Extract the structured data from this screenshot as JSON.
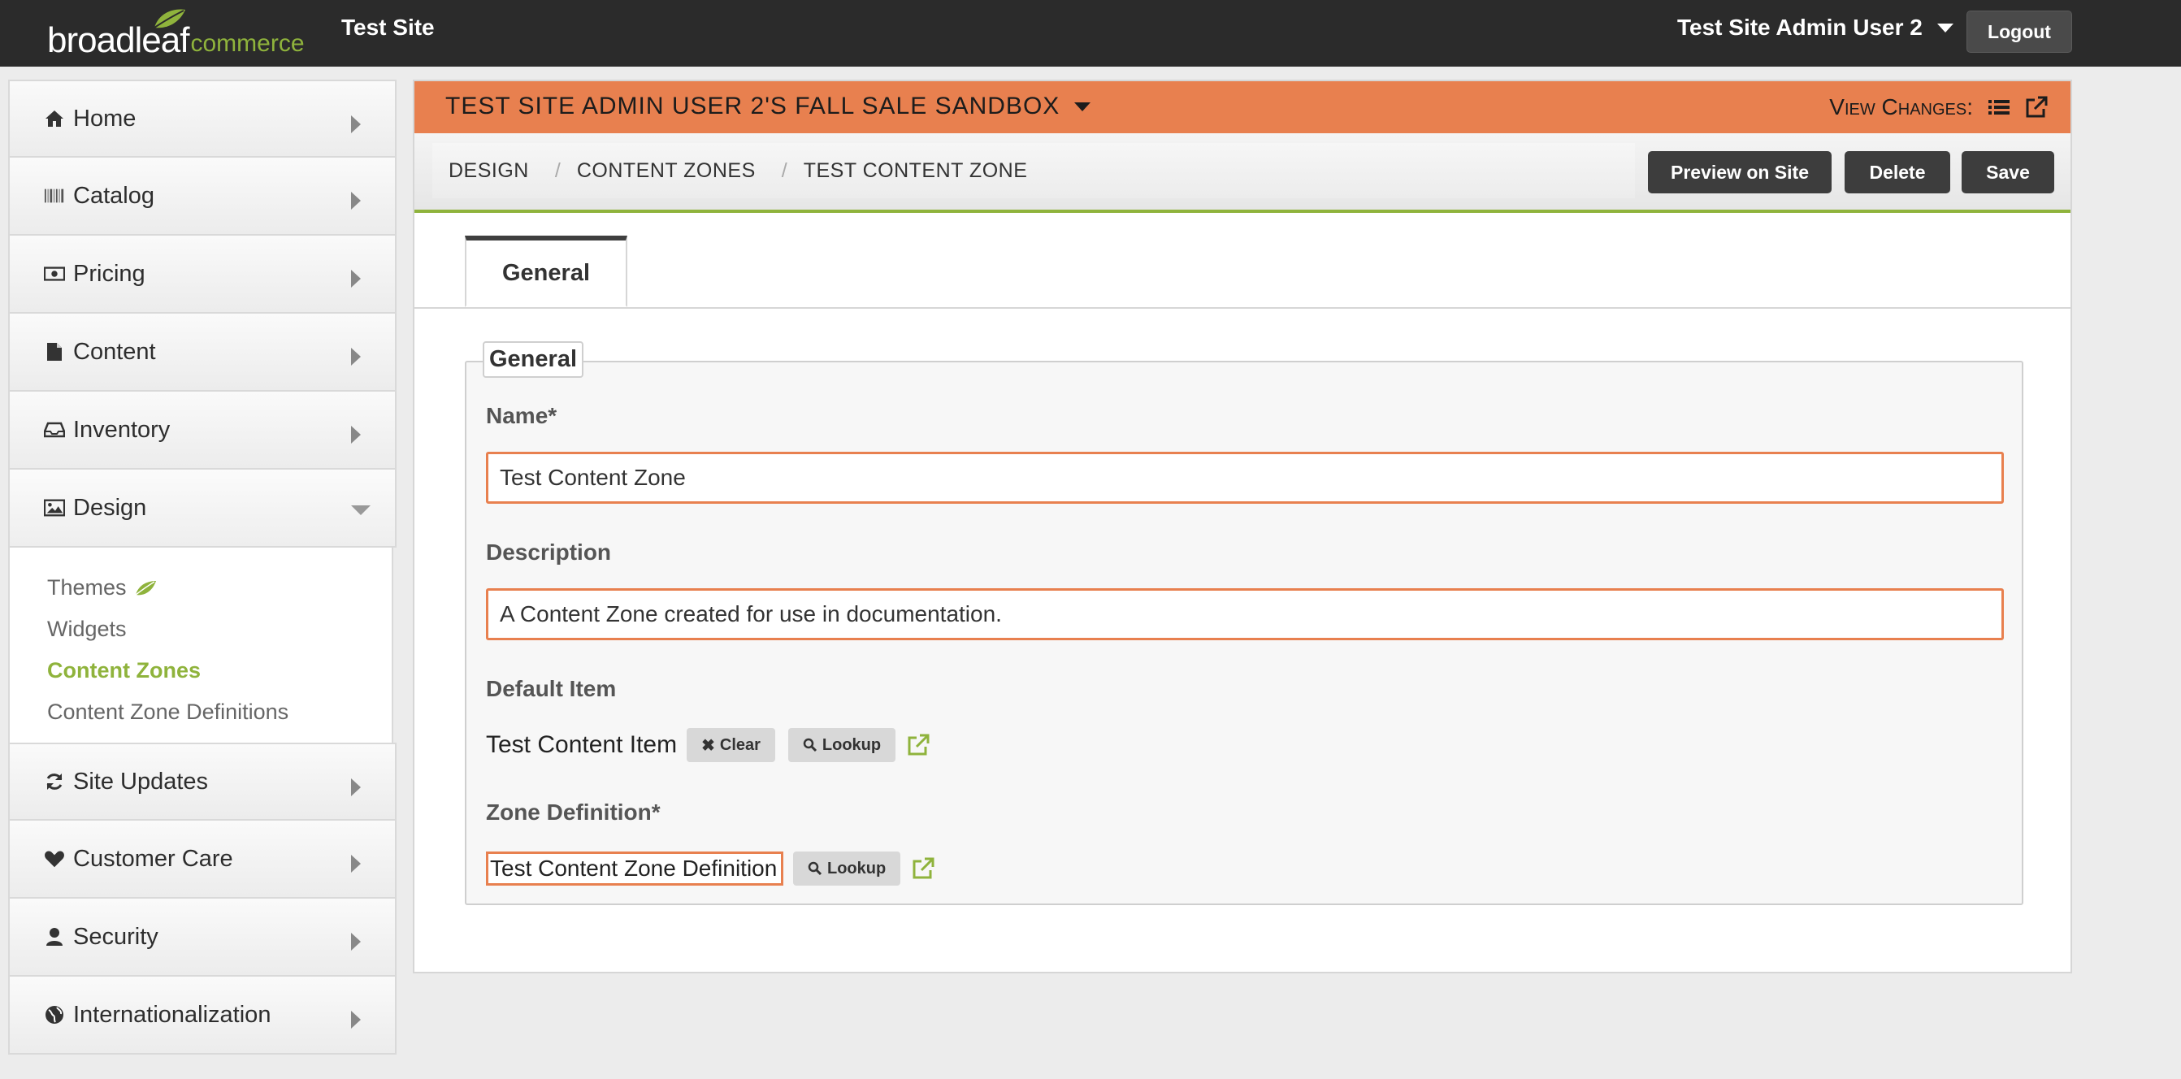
{
  "topbar": {
    "logo_main": "broadleaf",
    "logo_sub": "commerce",
    "site_name": "Test Site",
    "user_name": "Test Site Admin User 2",
    "logout_label": "Logout"
  },
  "sidebar": {
    "items": [
      {
        "label": "Home",
        "icon": "home-icon"
      },
      {
        "label": "Catalog",
        "icon": "barcode-icon"
      },
      {
        "label": "Pricing",
        "icon": "money-icon"
      },
      {
        "label": "Content",
        "icon": "file-icon"
      },
      {
        "label": "Inventory",
        "icon": "inbox-icon"
      },
      {
        "label": "Design",
        "icon": "picture-icon",
        "expanded": true
      },
      {
        "label": "Site Updates",
        "icon": "refresh-icon"
      },
      {
        "label": "Customer Care",
        "icon": "heart-icon"
      },
      {
        "label": "Security",
        "icon": "user-icon"
      },
      {
        "label": "Internationalization",
        "icon": "globe-icon"
      }
    ],
    "design_subitems": [
      {
        "label": "Themes",
        "icon": "leaf-icon"
      },
      {
        "label": "Widgets"
      },
      {
        "label": "Content Zones",
        "active": true
      },
      {
        "label": "Content Zone Definitions"
      }
    ]
  },
  "sandbox": {
    "title": "Test Site Admin User 2's Fall Sale Sandbox",
    "view_changes_label": "View Changes:"
  },
  "breadcrumb": [
    "DESIGN",
    "CONTENT ZONES",
    "TEST CONTENT ZONE"
  ],
  "actions": {
    "preview": "Preview on Site",
    "delete": "Delete",
    "save": "Save"
  },
  "tabs": [
    "General"
  ],
  "form": {
    "legend": "General",
    "name_label": "Name*",
    "name_value": "Test Content Zone",
    "description_label": "Description",
    "description_value": "A Content Zone created for use in documentation.",
    "default_item_label": "Default Item",
    "default_item_value": "Test Content Item",
    "clear_label": "Clear",
    "lookup_label": "Lookup",
    "zone_def_label": "Zone Definition*",
    "zone_def_value": "Test Content Zone Definition"
  },
  "colors": {
    "accent_orange": "#e8804f",
    "brand_green": "#8fb33c",
    "topbar": "#2b2b2b"
  }
}
